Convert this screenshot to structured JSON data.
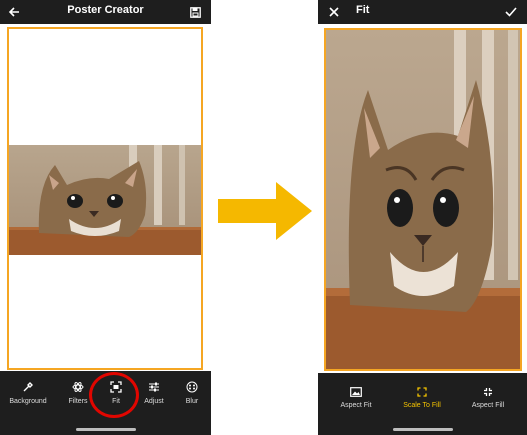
{
  "left_screen": {
    "title": "Poster Creator",
    "tools": [
      {
        "label": "Background",
        "icon": "eyedropper-icon"
      },
      {
        "label": "Filters",
        "icon": "atom-icon"
      },
      {
        "label": "Fit",
        "icon": "fit-icon"
      },
      {
        "label": "Adjust",
        "icon": "sliders-icon"
      },
      {
        "label": "Blur",
        "icon": "blur-icon"
      }
    ],
    "highlighted_tool": "Fit"
  },
  "right_screen": {
    "title": "Fit",
    "fit_modes": [
      {
        "label": "Aspect Fit",
        "icon": "aspect-fit-icon"
      },
      {
        "label": "Scale To Fill",
        "icon": "scale-to-fill-icon"
      },
      {
        "label": "Aspect Fill",
        "icon": "aspect-fill-icon"
      }
    ],
    "selected_mode": "Scale To Fill"
  },
  "colors": {
    "bar_background": "#1e1e1e",
    "frame_border": "#f5a623",
    "arrow": "#f5b800",
    "highlight_ring": "#e10600",
    "selected_mode": "#f5c400"
  }
}
